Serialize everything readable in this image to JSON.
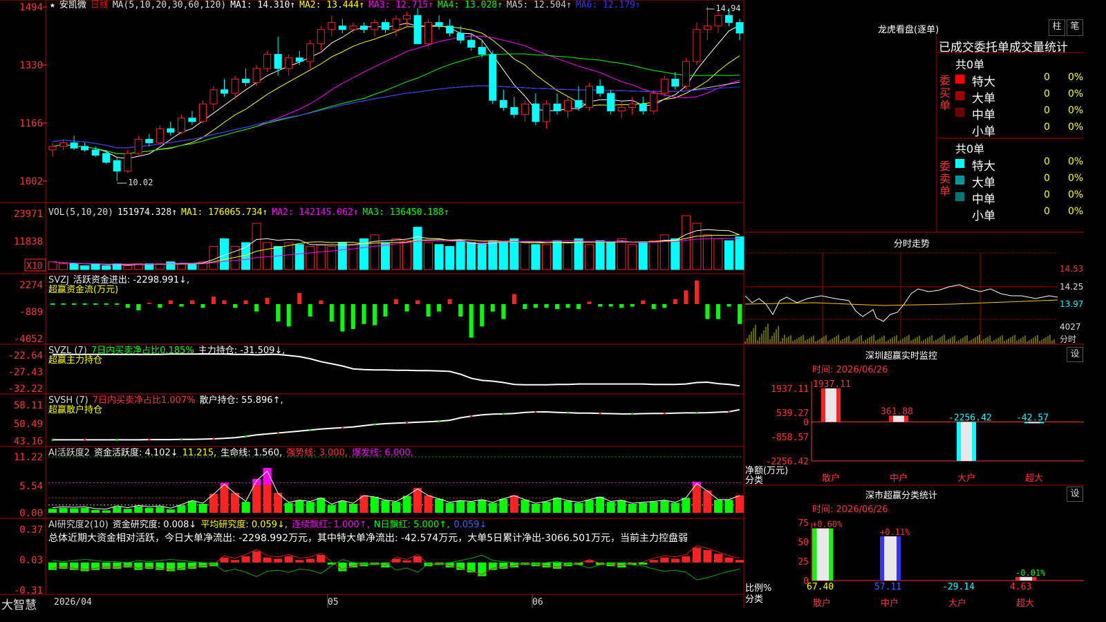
{
  "stock": {
    "star": "★",
    "name": "安凯微",
    "period": "日线"
  },
  "ma_line": {
    "label": "MA(5,10,20,30,60,120)",
    "items": [
      {
        "text": "MA1: 14.310↑",
        "color": "#ffffff"
      },
      {
        "text": "MA2: 13.444↑",
        "color": "#ffff00"
      },
      {
        "text": "MA3: 12.715↑",
        "color": "#ff00ff"
      },
      {
        "text": "MA4: 13.028↑",
        "color": "#00ff00"
      },
      {
        "text": "MA5: 12.504↑",
        "color": "#cccccc"
      },
      {
        "text": "MA6: 12.179↑",
        "color": "#3333ff"
      }
    ]
  },
  "price_axis": [
    "1494",
    "1330",
    "1166",
    "1002"
  ],
  "price_annotations": {
    "high": "14.94",
    "low": "10.02"
  },
  "vol": {
    "label": "VOL(5,10,20)",
    "v": "151974.328↑",
    "ma1": "MA1: 176065.734↑",
    "ma2": "MA2: 142145.062↑",
    "ma3": "MA3: 136450.188↑",
    "axis": [
      "23971",
      "11838"
    ],
    "unit": "X10"
  },
  "svzj": {
    "label": "SVZJ",
    "desc": "活跃资金进出: -2298.991↓,",
    "sub": "超赢资金流(万元)",
    "axis": [
      "2274",
      "-889",
      "-4052"
    ]
  },
  "svzl": {
    "label": "SVZL (7)",
    "desc1": "7日内买卖净占比0.185%",
    "desc2": "主力持仓: -31.509↓,",
    "sub": "超赢主力持仓",
    "axis": [
      "-22.64",
      "-27.43",
      "-32.22"
    ]
  },
  "svsh": {
    "label": "SVSH (7)",
    "desc1": "7日内买卖净占比1.007%",
    "desc2": "散户持仓: 55.896↑,",
    "sub": "超赢散户持仓",
    "axis": [
      "58.11",
      "50.49",
      "43.16"
    ]
  },
  "ai1": {
    "label": "AI活跃度2",
    "a": "资金活跃度: 4.102↓",
    "b": "11.215,",
    "c": "生命线: 1.560,",
    "d": "强势线: 3.000,",
    "e": "爆发线: 6.000,",
    "axis": [
      "11.22",
      "5.54",
      "0.00"
    ]
  },
  "ai2": {
    "label": "AI研究度2(10)",
    "a": "资金研究度: 0.008↓",
    "b": "平均研究度: 0.059↓,",
    "c": "连续飘红: 1.000↑,",
    "d": "N日飘红: 5.000↑,",
    "e": "0.059↓",
    "summary": "总体近期大资金相对活跃，今日大单净流出: -2298.992万元，其中特大单净流出: -42.574万元，大单5日累计净出-3066.501万元，当前主力控盘弱",
    "axis": [
      "0.37",
      "0.03",
      "-0.31"
    ]
  },
  "date_axis": {
    "brand": "大智慧",
    "d1": "2026/04",
    "d2": "05",
    "d3": "06"
  },
  "right": {
    "lhb": {
      "title": "龙虎看盘(逐单)",
      "btn1": "柱",
      "btn2": "笔",
      "header": "已成交委托单成交量统计"
    },
    "buy": {
      "side": "委买单",
      "total": "共0单",
      "rows": [
        {
          "label": "特大",
          "val": "0",
          "pct": "0%",
          "color": "#ff0000"
        },
        {
          "label": "大单",
          "val": "0",
          "pct": "0%",
          "color": "#a00000"
        },
        {
          "label": "中单",
          "val": "0",
          "pct": "0%",
          "color": "#700000"
        },
        {
          "label": "小单",
          "val": "0",
          "pct": "0%",
          "color": "#000000"
        }
      ]
    },
    "sell": {
      "side": "委卖单",
      "total": "共0单",
      "rows": [
        {
          "label": "特大",
          "val": "0",
          "pct": "0%",
          "color": "#00ffff"
        },
        {
          "label": "大单",
          "val": "0",
          "pct": "0%",
          "color": "#009999"
        },
        {
          "label": "中单",
          "val": "0",
          "pct": "0%",
          "color": "#007777"
        },
        {
          "label": "小单",
          "val": "0",
          "pct": "0%",
          "color": "#000000"
        }
      ]
    },
    "fenshi": {
      "title": "分时走势",
      "p1": "14.53",
      "p2": "14.25",
      "p3": "13.97",
      "v": "4027",
      "vlabel": "分时"
    },
    "monitor": {
      "title": "深圳超赢实时监控",
      "btn": "设",
      "time": "时间: 2026/06/26",
      "axis": [
        "1937.11",
        "539.27",
        "0",
        "-858.57",
        "-2256.42"
      ],
      "ylabel": "净额(万元)",
      "xlabel": "分类",
      "bars": [
        {
          "cat": "散户",
          "val": 1937.11,
          "label": "1937.11"
        },
        {
          "cat": "中户",
          "val": 361.88,
          "label": "361.88"
        },
        {
          "cat": "大户",
          "val": -2256.42,
          "label": "-2256.42"
        },
        {
          "cat": "超大",
          "val": -42.57,
          "label": "-42.57"
        }
      ]
    },
    "classify": {
      "title": "深市超赢分类统计",
      "btn": "设",
      "time": "时间: 2026/06/26",
      "axis": [
        "75",
        "50",
        "25",
        "0"
      ],
      "ylabel": "比例%",
      "xlabel": "分类",
      "bars": [
        {
          "cat": "散户",
          "top": "+0.60%",
          "val": 67.4,
          "label": "67.40"
        },
        {
          "cat": "中户",
          "top": "+0.11%",
          "val": 57.11,
          "label": "57.11"
        },
        {
          "cat": "大户",
          "top": "",
          "val": -29.14,
          "label": "-29.14"
        },
        {
          "cat": "超大",
          "top": "-0.01%",
          "val": 4.63,
          "label": "4.63"
        }
      ]
    }
  },
  "chart_data": {
    "type": "candlestick",
    "ylim": [
      10.02,
      14.94
    ],
    "grid": false,
    "ohlc": [
      [
        10.9,
        11.1,
        10.7,
        11.0
      ],
      [
        11.0,
        11.2,
        10.9,
        11.1
      ],
      [
        11.1,
        11.3,
        10.9,
        10.95
      ],
      [
        11.0,
        11.1,
        10.85,
        10.9
      ],
      [
        10.9,
        11.0,
        10.7,
        10.75
      ],
      [
        10.8,
        10.9,
        10.5,
        10.55
      ],
      [
        10.6,
        10.7,
        10.02,
        10.3
      ],
      [
        10.3,
        10.9,
        10.25,
        10.8
      ],
      [
        10.8,
        11.3,
        10.75,
        11.2
      ],
      [
        11.2,
        11.35,
        11.0,
        11.1
      ],
      [
        11.1,
        11.6,
        11.05,
        11.5
      ],
      [
        11.5,
        11.7,
        11.3,
        11.4
      ],
      [
        11.4,
        11.9,
        11.35,
        11.8
      ],
      [
        11.8,
        12.0,
        11.6,
        11.7
      ],
      [
        11.7,
        12.3,
        11.65,
        12.2
      ],
      [
        12.2,
        12.7,
        12.0,
        12.6
      ],
      [
        12.6,
        12.9,
        12.4,
        12.5
      ],
      [
        12.5,
        13.0,
        12.3,
        12.9
      ],
      [
        12.9,
        13.2,
        12.7,
        12.8
      ],
      [
        12.8,
        13.3,
        12.7,
        13.2
      ],
      [
        13.2,
        13.7,
        13.1,
        13.6
      ],
      [
        13.6,
        14.1,
        13.0,
        13.2
      ],
      [
        13.2,
        13.6,
        13.0,
        13.5
      ],
      [
        13.5,
        13.7,
        13.3,
        13.4
      ],
      [
        13.4,
        14.0,
        13.2,
        13.9
      ],
      [
        13.9,
        14.4,
        13.7,
        14.3
      ],
      [
        14.3,
        14.7,
        14.1,
        14.5
      ],
      [
        14.4,
        14.6,
        14.2,
        14.3
      ],
      [
        14.3,
        14.5,
        14.2,
        14.4
      ],
      [
        14.4,
        14.5,
        14.2,
        14.3
      ],
      [
        14.3,
        14.6,
        14.1,
        14.5
      ],
      [
        14.5,
        14.6,
        14.2,
        14.3
      ],
      [
        14.3,
        14.7,
        14.1,
        14.6
      ],
      [
        14.6,
        14.8,
        14.4,
        14.7
      ],
      [
        14.7,
        14.9,
        14.0,
        13.9
      ],
      [
        13.9,
        14.6,
        13.8,
        14.5
      ],
      [
        14.5,
        14.7,
        14.3,
        14.4
      ],
      [
        14.4,
        14.6,
        14.1,
        14.2
      ],
      [
        14.2,
        14.4,
        13.9,
        14.0
      ],
      [
        14.0,
        14.2,
        13.7,
        13.8
      ],
      [
        13.8,
        14.0,
        13.5,
        13.6
      ],
      [
        13.6,
        13.7,
        12.2,
        12.3
      ],
      [
        12.3,
        12.6,
        12.0,
        12.1
      ],
      [
        12.1,
        12.4,
        11.8,
        11.9
      ],
      [
        11.9,
        12.3,
        11.7,
        12.2
      ],
      [
        12.2,
        12.5,
        11.6,
        11.7
      ],
      [
        11.7,
        12.3,
        11.5,
        12.2
      ],
      [
        12.2,
        12.5,
        11.9,
        12.0
      ],
      [
        12.0,
        12.4,
        11.8,
        12.3
      ],
      [
        12.3,
        12.7,
        12.0,
        12.1
      ],
      [
        12.1,
        12.8,
        12.0,
        12.7
      ],
      [
        12.7,
        12.9,
        12.4,
        12.5
      ],
      [
        12.5,
        12.6,
        11.9,
        12.0
      ],
      [
        12.0,
        12.3,
        11.8,
        12.1
      ],
      [
        12.1,
        12.4,
        11.9,
        12.2
      ],
      [
        12.2,
        12.4,
        11.9,
        12.0
      ],
      [
        12.0,
        12.6,
        11.9,
        12.5
      ],
      [
        12.5,
        13.0,
        12.4,
        12.9
      ],
      [
        12.9,
        13.1,
        12.6,
        12.7
      ],
      [
        12.7,
        13.5,
        12.6,
        13.4
      ],
      [
        13.4,
        14.5,
        13.3,
        14.3
      ],
      [
        14.3,
        14.94,
        14.0,
        14.4
      ],
      [
        14.4,
        14.8,
        14.2,
        14.7
      ],
      [
        14.7,
        14.9,
        14.4,
        14.5
      ],
      [
        14.5,
        14.6,
        14.0,
        14.2
      ]
    ],
    "volume": [
      4,
      3,
      3,
      2,
      3,
      2,
      3,
      2,
      3,
      3,
      3,
      4,
      3,
      3,
      4,
      12,
      16,
      12,
      14,
      24,
      14,
      12,
      14,
      13,
      12,
      13,
      12,
      14,
      13,
      16,
      18,
      14,
      16,
      15,
      22,
      14,
      13,
      12,
      15,
      14,
      13,
      15,
      14,
      16,
      14,
      13,
      13,
      15,
      14,
      16,
      13,
      15,
      14,
      16,
      13,
      14,
      15,
      18,
      16,
      28,
      24,
      18,
      16,
      15,
      17
    ],
    "svzj": [
      0,
      0,
      0,
      0,
      0,
      0,
      0,
      -0.3,
      -0.5,
      0.1,
      -0.3,
      0.3,
      -0.2,
      0.3,
      -0.3,
      0.6,
      0.3,
      -0.3,
      0.3,
      -0.6,
      0.5,
      -1.4,
      -1.8,
      0.9,
      -1.0,
      0.3,
      -1.4,
      -2.2,
      -2.0,
      -1.6,
      -1.7,
      -1.0,
      0.4,
      -0.6,
      0.3,
      -1.0,
      -0.6,
      0.4,
      -1.0,
      -2.7,
      -1.8,
      -0.6,
      -1.2,
      0.8,
      -0.4,
      -0.3,
      -0.3,
      -0.4,
      -0.3,
      -0.4,
      0.2,
      -0.2,
      -0.2,
      -0.3,
      -0.2,
      0.3,
      -0.4,
      -0.3,
      0.4,
      1.1,
      1.9,
      -1.2,
      -1.2,
      -0.2,
      -1.6
    ],
    "svzl": [
      -22.8,
      -22.8,
      -22.8,
      -22.8,
      -22.8,
      -22.8,
      -22.8,
      -22.8,
      -22.8,
      -22.8,
      -22.8,
      -22.7,
      -22.7,
      -22.7,
      -22.7,
      -22.7,
      -22.7,
      -22.8,
      -22.8,
      -22.9,
      -22.8,
      -22.8,
      -23.1,
      -23.4,
      -24.0,
      -24.8,
      -25.4,
      -26.0,
      -26.8,
      -27.0,
      -27.1,
      -27.1,
      -27.2,
      -27.2,
      -27.3,
      -27.3,
      -27.4,
      -27.5,
      -28.3,
      -29.4,
      -30.0,
      -30.2,
      -30.6,
      -31.1,
      -31.2,
      -31.2,
      -31.2,
      -31.1,
      -31.1,
      -31.0,
      -31.0,
      -31.0,
      -31.0,
      -31.0,
      -31.0,
      -31.0,
      -31.1,
      -31.1,
      -31.1,
      -31.0,
      -30.6,
      -30.5,
      -30.9,
      -31.1,
      -31.5
    ],
    "svsh": [
      43.6,
      43.6,
      43.6,
      43.6,
      43.6,
      43.6,
      43.6,
      43.6,
      43.6,
      43.7,
      43.7,
      43.7,
      43.8,
      43.8,
      43.9,
      44.0,
      44.2,
      44.5,
      45.0,
      45.6,
      46.0,
      46.4,
      46.8,
      47.2,
      47.6,
      48.0,
      48.3,
      48.6,
      48.9,
      49.4,
      49.9,
      50.2,
      50.4,
      50.6,
      50.8,
      51.0,
      51.2,
      51.6,
      52.6,
      53.3,
      53.8,
      54.1,
      54.2,
      54.4,
      54.8,
      55.0,
      55.0,
      54.8,
      54.7,
      54.5,
      54.5,
      54.4,
      54.3,
      54.2,
      54.2,
      54.3,
      54.4,
      54.4,
      54.5,
      54.6,
      54.6,
      54.7,
      54.9,
      55.1,
      55.9
    ],
    "ai1": [
      0.8,
      1.0,
      0.9,
      1.0,
      0.6,
      0.5,
      1.2,
      0.8,
      1.3,
      1.0,
      1.2,
      0.7,
      1.5,
      2.4,
      1.8,
      3.8,
      6.0,
      4.0,
      2.2,
      6.8,
      9.0,
      4.0,
      2.0,
      2.5,
      2.2,
      3.0,
      1.6,
      2.4,
      1.8,
      3.5,
      3.2,
      2.5,
      2.2,
      3.4,
      5.0,
      3.5,
      2.8,
      2.0,
      2.4,
      2.2,
      2.6,
      2.0,
      2.8,
      3.5,
      2.6,
      1.8,
      2.2,
      3.0,
      2.4,
      2.0,
      2.6,
      3.2,
      2.2,
      2.5,
      1.8,
      2.0,
      2.2,
      2.5,
      2.0,
      3.0,
      6.2,
      4.5,
      2.6,
      2.6,
      3.5
    ],
    "ai2": [
      -0.06,
      -0.05,
      -0.06,
      -0.07,
      -0.06,
      -0.05,
      -0.05,
      -0.04,
      -0.06,
      -0.05,
      -0.06,
      -0.07,
      -0.06,
      -0.05,
      -0.04,
      -0.03,
      0.04,
      0.02,
      0.05,
      0.09,
      0.04,
      0.03,
      0.05,
      0.02,
      0.03,
      0.06,
      -0.01,
      -0.07,
      -0.04,
      -0.03,
      -0.02,
      -0.04,
      0.03,
      0.01,
      0.05,
      -0.03,
      -0.02,
      -0.04,
      -0.06,
      -0.08,
      -0.11,
      -0.06,
      -0.05,
      -0.04,
      -0.02,
      -0.03,
      -0.04,
      -0.05,
      -0.03,
      -0.02,
      0.01,
      -0.02,
      -0.03,
      -0.04,
      -0.02,
      -0.01,
      0.02,
      0.04,
      0.03,
      0.05,
      0.12,
      0.1,
      0.07,
      0.04,
      0.02
    ]
  }
}
